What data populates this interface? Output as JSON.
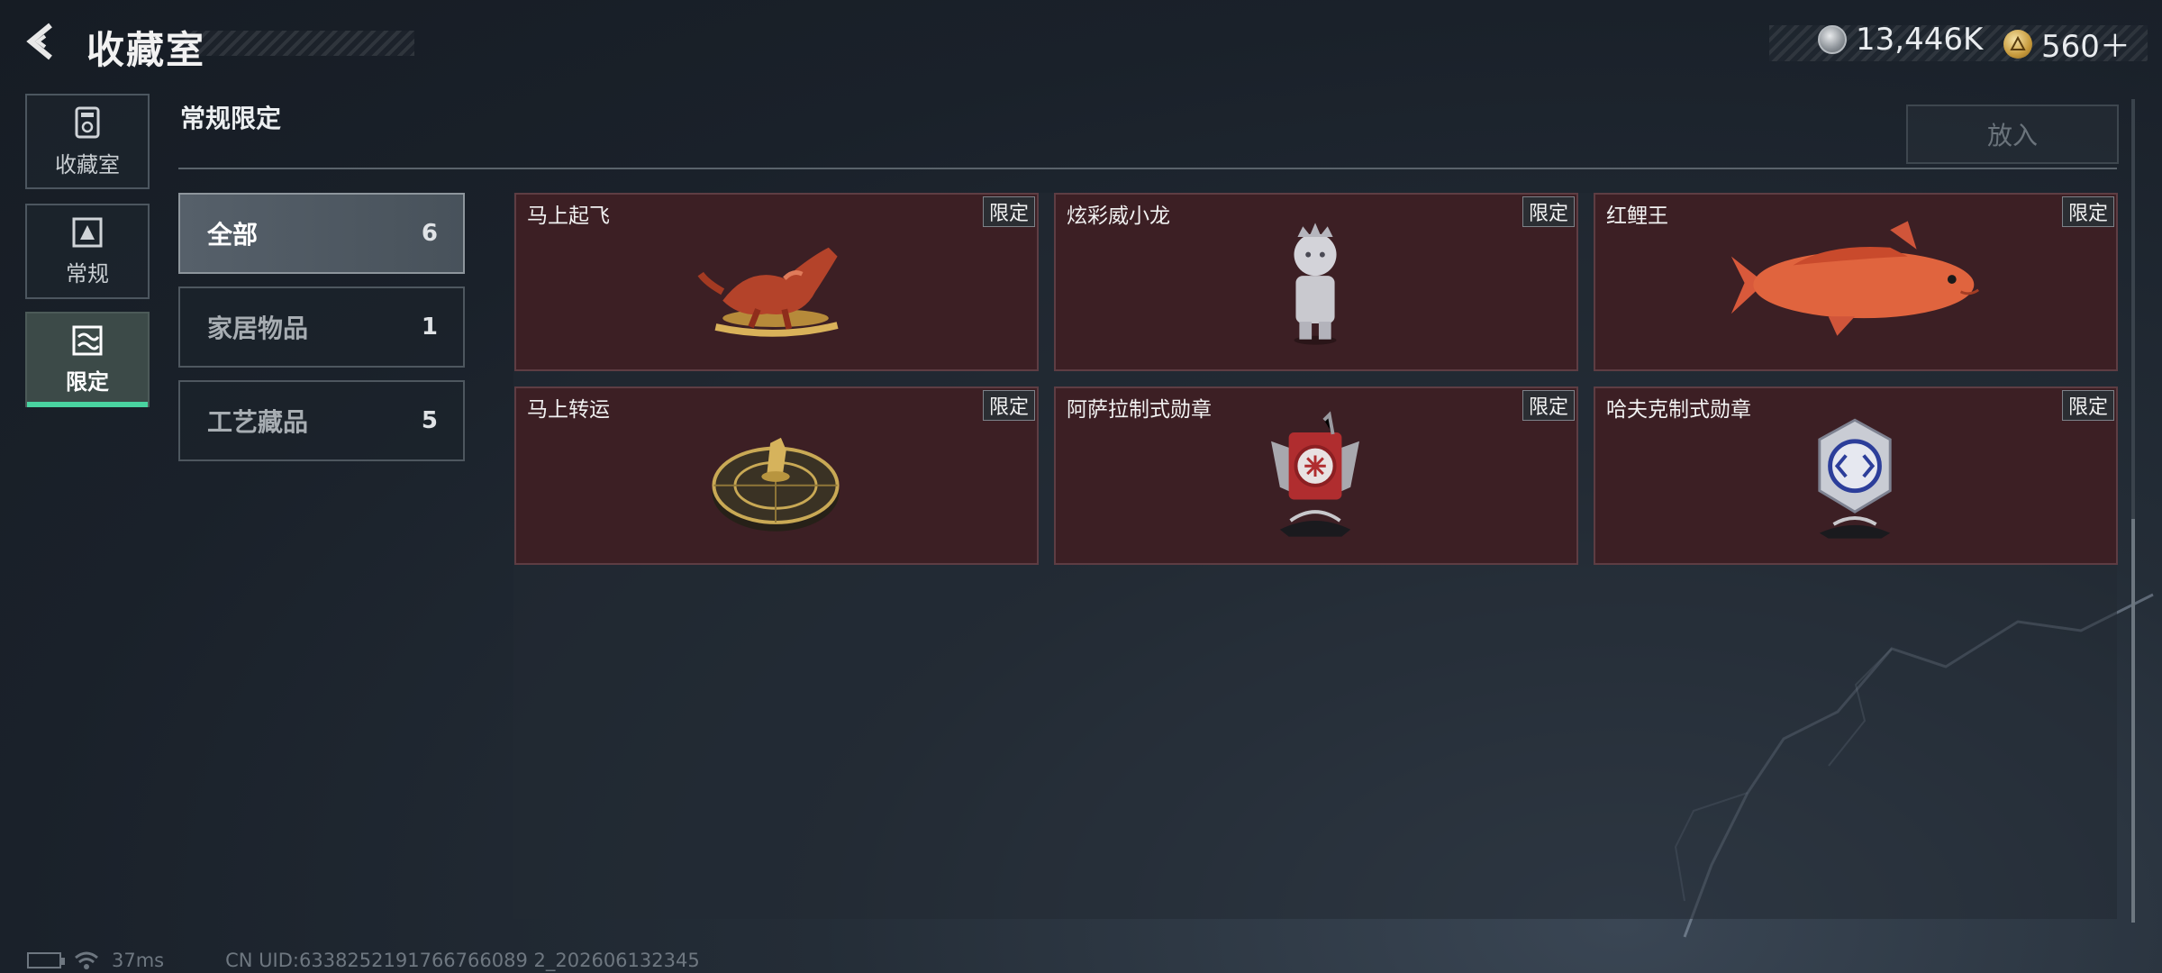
{
  "header": {
    "title": "收藏室",
    "currency": [
      {
        "icon": "silver-coin-icon",
        "value": "13,446K"
      },
      {
        "icon": "gold-coin-icon",
        "value": "560＋"
      }
    ]
  },
  "nav": {
    "items": [
      {
        "label": "收藏室",
        "icon": "collection-icon",
        "active": false
      },
      {
        "label": "常规",
        "icon": "regular-icon",
        "active": false
      },
      {
        "label": "限定",
        "icon": "limited-icon",
        "active": true
      }
    ]
  },
  "section": {
    "title": "常规限定",
    "put_label": "放入"
  },
  "categories": [
    {
      "name": "全部",
      "count": "6",
      "active": true
    },
    {
      "name": "家居物品",
      "count": "1",
      "active": false
    },
    {
      "name": "工艺藏品",
      "count": "5",
      "active": false
    }
  ],
  "items": [
    {
      "name": "马上起飞",
      "tag": "限定",
      "art": "horse-sculpture"
    },
    {
      "name": "炫彩威小龙",
      "tag": "限定",
      "art": "dragon-figure"
    },
    {
      "name": "红鲤王",
      "tag": "限定",
      "art": "koi-fish"
    },
    {
      "name": "马上转运",
      "tag": "限定",
      "art": "horse-compass"
    },
    {
      "name": "阿萨拉制式勋章",
      "tag": "限定",
      "art": "asala-medal"
    },
    {
      "name": "哈夫克制式勋章",
      "tag": "限定",
      "art": "haavk-medal"
    }
  ],
  "footer": {
    "ping": "37ms",
    "uid": "CN UID:6338252191766766089 2_202606132345"
  },
  "colors": {
    "accent": "#49d3a0",
    "card_bg": "#3c1f24"
  }
}
